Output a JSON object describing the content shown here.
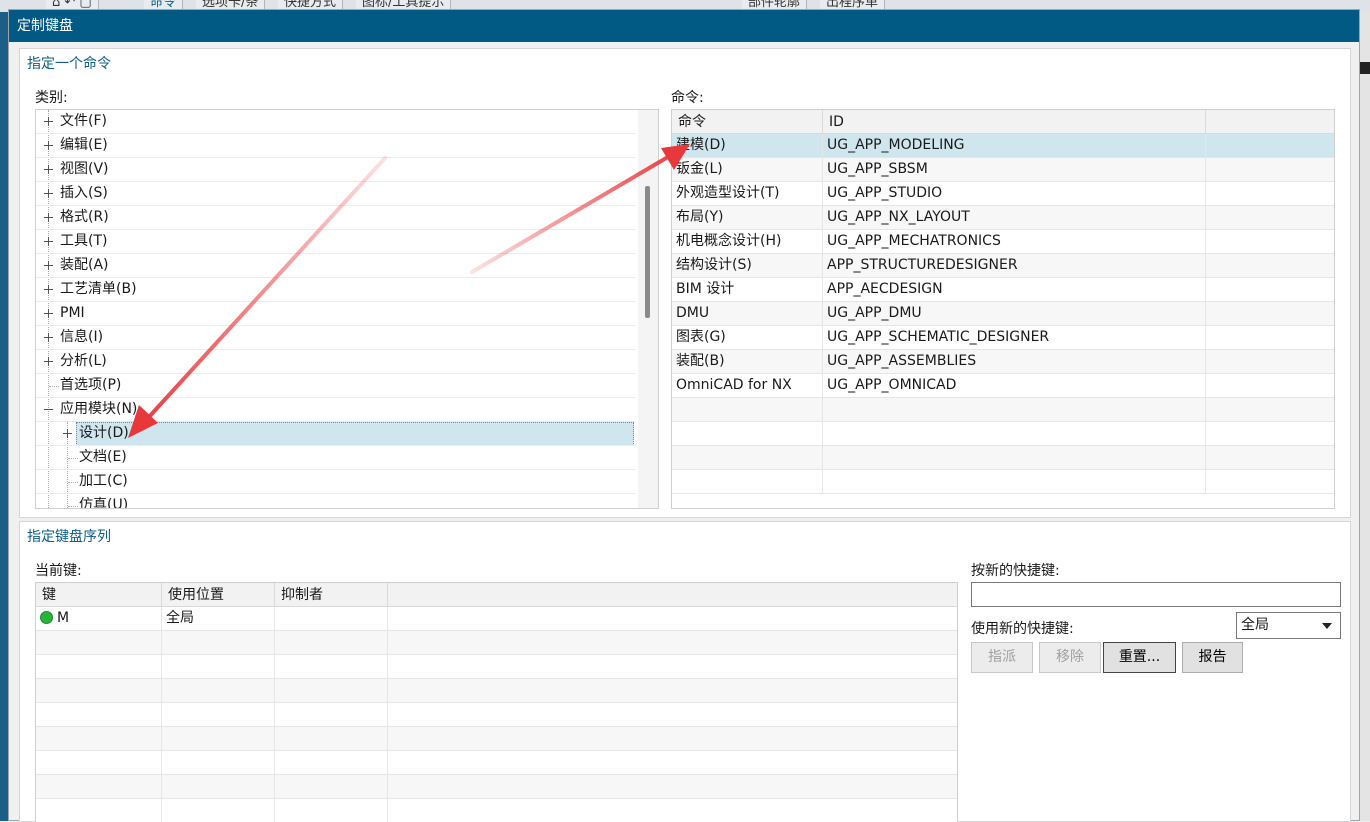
{
  "background_app": {
    "tabs": [
      "命令",
      "选项卡/条",
      "快捷方式",
      "图标/工具提示",
      "部件轮廓",
      "出程序单"
    ]
  },
  "dialog": {
    "title": "定制键盘",
    "assign_command": {
      "group_title": "指定一个命令",
      "categories_label": "类别:",
      "commands_label": "命令:",
      "tree": [
        {
          "label": "文件(F)",
          "expander": "plus",
          "level": 0
        },
        {
          "label": "编辑(E)",
          "expander": "plus",
          "level": 0
        },
        {
          "label": "视图(V)",
          "expander": "plus",
          "level": 0
        },
        {
          "label": "插入(S)",
          "expander": "plus",
          "level": 0
        },
        {
          "label": "格式(R)",
          "expander": "plus",
          "level": 0
        },
        {
          "label": "工具(T)",
          "expander": "plus",
          "level": 0
        },
        {
          "label": "装配(A)",
          "expander": "plus",
          "level": 0
        },
        {
          "label": "工艺清单(B)",
          "expander": "plus",
          "level": 0
        },
        {
          "label": "PMI",
          "expander": "plus",
          "level": 0
        },
        {
          "label": "信息(I)",
          "expander": "plus",
          "level": 0
        },
        {
          "label": "分析(L)",
          "expander": "plus",
          "level": 0
        },
        {
          "label": "首选项(P)",
          "expander": "none",
          "level": 0
        },
        {
          "label": "应用模块(N)",
          "expander": "minus",
          "level": 0
        },
        {
          "label": "设计(D)",
          "expander": "plus",
          "level": 1,
          "selected": true
        },
        {
          "label": "文档(E)",
          "expander": "none",
          "level": 1
        },
        {
          "label": "加工(C)",
          "expander": "none",
          "level": 1
        },
        {
          "label": "仿真(U)",
          "expander": "none",
          "level": 1
        }
      ],
      "command_columns": [
        "命令",
        "ID"
      ],
      "commands": [
        {
          "name": "建模(D)",
          "id": "UG_APP_MODELING",
          "selected": true
        },
        {
          "name": "钣金(L)",
          "id": "UG_APP_SBSM"
        },
        {
          "name": "外观造型设计(T)",
          "id": "UG_APP_STUDIO"
        },
        {
          "name": "布局(Y)",
          "id": "UG_APP_NX_LAYOUT"
        },
        {
          "name": "机电概念设计(H)",
          "id": "UG_APP_MECHATRONICS"
        },
        {
          "name": "结构设计(S)",
          "id": "APP_STRUCTUREDESIGNER"
        },
        {
          "name": "BIM 设计",
          "id": "APP_AECDESIGN"
        },
        {
          "name": "DMU",
          "id": "UG_APP_DMU"
        },
        {
          "name": "图表(G)",
          "id": "UG_APP_SCHEMATIC_DESIGNER"
        },
        {
          "name": "装配(B)",
          "id": "UG_APP_ASSEMBLIES"
        },
        {
          "name": "OmniCAD for NX",
          "id": "UG_APP_OMNICAD"
        }
      ]
    },
    "key_sequence": {
      "group_title": "指定键盘序列",
      "current_keys_label": "当前键:",
      "key_columns": [
        "键",
        "使用位置",
        "抑制者"
      ],
      "keys": [
        {
          "key": "M",
          "location": "全局",
          "suppressed_by": ""
        }
      ],
      "new_shortcut_label": "按新的快捷键:",
      "new_shortcut_value": "",
      "use_new_shortcut_label": "使用新的快捷键:",
      "use_new_shortcut_value": "全局",
      "buttons": {
        "assign": "指派",
        "remove": "移除",
        "reset": "重置...",
        "report": "报告"
      }
    },
    "colors": {
      "title_bar": "#005a84",
      "selection": "#cfe6ee",
      "annotation_arrow": "#e8383b"
    }
  }
}
